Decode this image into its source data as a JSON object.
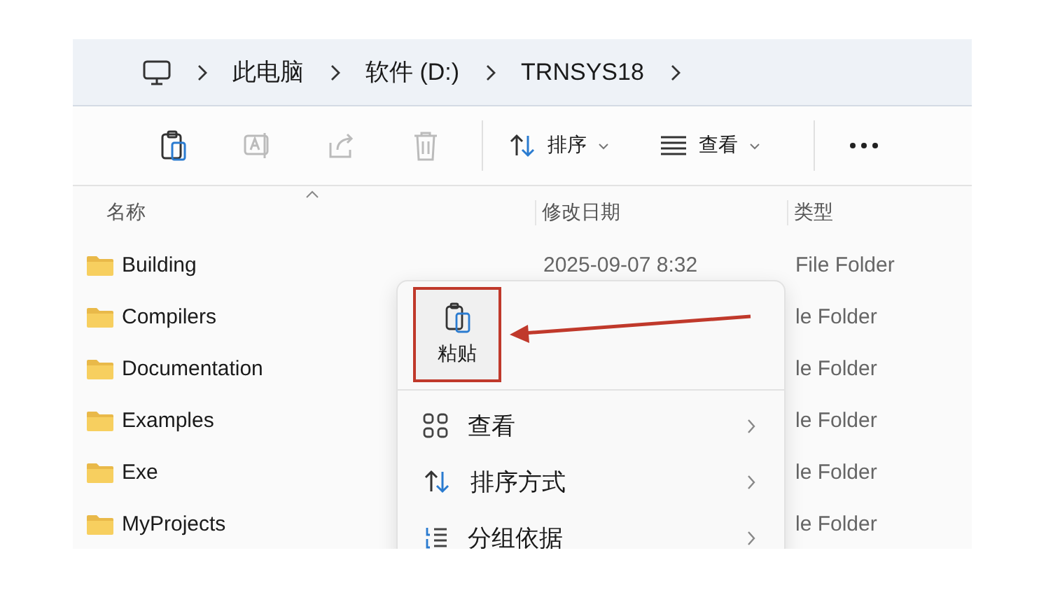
{
  "breadcrumb": {
    "items": [
      "此电脑",
      "软件 (D:)",
      "TRNSYS18"
    ]
  },
  "toolbar": {
    "sort_label": "排序",
    "view_label": "查看"
  },
  "columns": [
    "名称",
    "修改日期",
    "类型"
  ],
  "rows": [
    {
      "name": "Building",
      "date": "2025-09-07 8:32",
      "type": "File Folder"
    },
    {
      "name": "Compilers",
      "type": "le Folder"
    },
    {
      "name": "Documentation",
      "type": "le Folder"
    },
    {
      "name": "Examples",
      "type": "le Folder"
    },
    {
      "name": "Exe",
      "type": "le Folder"
    },
    {
      "name": "MyProjects",
      "type": "le Folder"
    }
  ],
  "context_menu": {
    "paste": {
      "label": "粘贴",
      "highlighted": true
    },
    "items": [
      {
        "label": "查看",
        "kind": "view"
      },
      {
        "label": "排序方式",
        "kind": "sort"
      },
      {
        "label": "分组依据",
        "kind": "group"
      }
    ]
  }
}
